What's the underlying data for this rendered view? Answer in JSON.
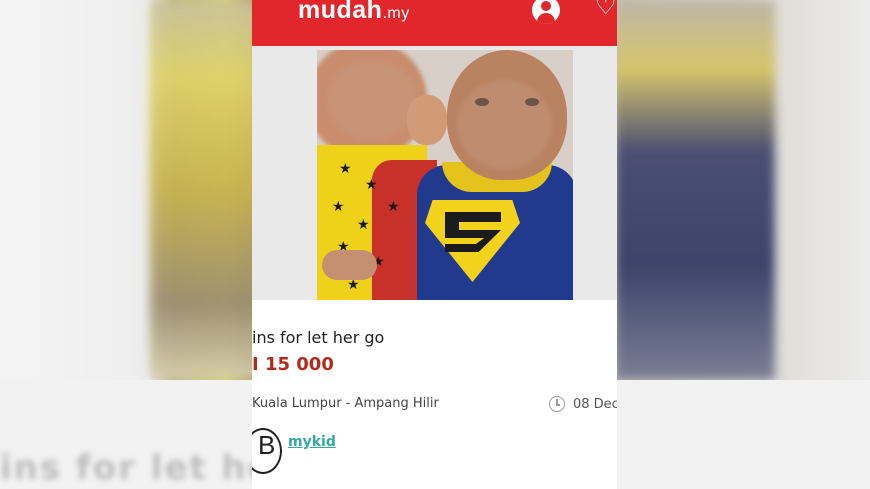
{
  "header": {
    "logo_text": "mudah",
    "logo_suffix": ".my",
    "profile_icon": "user-circle-icon",
    "favorite_icon": "heart-icon",
    "brand_color": "#e1262c"
  },
  "listing": {
    "title": "ins for let her go",
    "price": "I 15 000",
    "location": "Kuala Lumpur - Ampang Hilir",
    "date": "08 Dec",
    "price_color": "#b42a1f"
  },
  "seller": {
    "name": "mykid",
    "avatar_letter": "B",
    "name_color": "#31aaa6"
  },
  "background": {
    "ghost_text": "ins for let her"
  }
}
